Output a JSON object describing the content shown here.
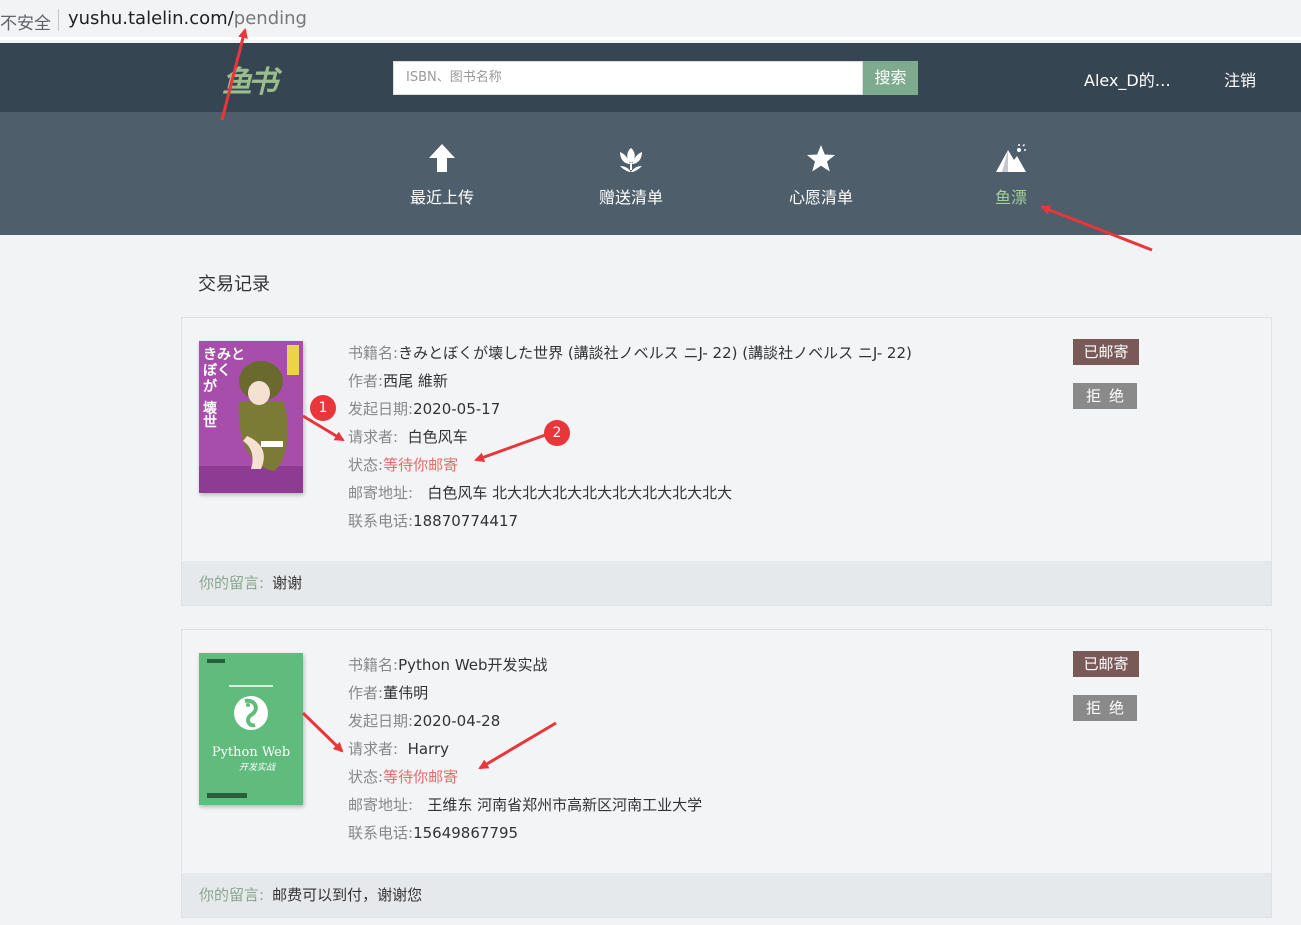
{
  "browser": {
    "security_label": "不安全",
    "url_host": "yushu.talelin.com/",
    "url_path": "pending"
  },
  "header": {
    "logo_text": "鱼书",
    "search_placeholder": "ISBN、图书名称",
    "search_button": "搜索",
    "username": "Alex_D的…",
    "logout": "注销"
  },
  "nav": {
    "items": [
      {
        "label": "最近上传",
        "icon": "arrow-up-icon"
      },
      {
        "label": "赠送清单",
        "icon": "flower-icon"
      },
      {
        "label": "心愿清单",
        "icon": "star-icon"
      },
      {
        "label": "鱼漂",
        "icon": "mountain-icon",
        "active": true
      }
    ],
    "active_color": "#a3d09e"
  },
  "page": {
    "section_title": "交易记录"
  },
  "labels": {
    "book_name": "书籍名:",
    "author": "作者:",
    "date": "发起日期:",
    "requester": "请求者:",
    "status": "状态:",
    "address": "邮寄地址:",
    "phone": "联系电话:",
    "message": "你的留言:",
    "btn_mailed": "已邮寄",
    "btn_reject": "拒绝"
  },
  "records": [
    {
      "title": "きみとぼくが壊した世界 (講談社ノベルス ニJ- 22) (講談社ノベルス ニJ- 22)",
      "author": "西尾 維新",
      "date": "2020-05-17",
      "requester": "白色风车",
      "status": "等待你邮寄",
      "address": "白色风车 北大北大北大北大北大北大北大北大",
      "phone": "18870774417",
      "message": "谢谢",
      "cover_color": "#a64ea9"
    },
    {
      "title": "Python Web开发实战",
      "author": "董伟明",
      "date": "2020-04-28",
      "requester": "Harry",
      "status": "等待你邮寄",
      "address": "王维东 河南省郑州市高新区河南工业大学",
      "phone": "15649867795",
      "message": "邮费可以到付，谢谢您",
      "cover_color": "#5fbc7c",
      "cover_text": "Python Web",
      "cover_subtext": "开发实战"
    }
  ],
  "annotations": {
    "badge_1": "1",
    "badge_2": "2",
    "color": "#e8363a"
  }
}
